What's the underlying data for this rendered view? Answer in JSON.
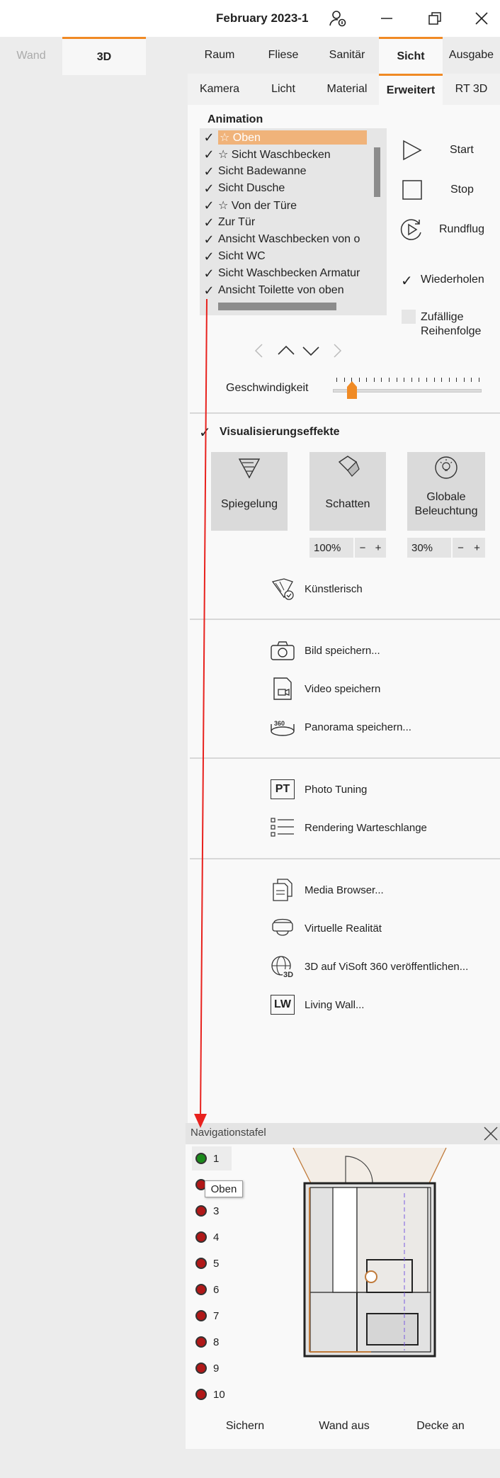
{
  "window": {
    "title": "February 2023-1",
    "controls": [
      "user-settings-icon",
      "minimize-icon",
      "restore-icon",
      "close-icon"
    ]
  },
  "view_tabs": [
    {
      "label": "Wand",
      "active": false
    },
    {
      "label": "3D",
      "active": true
    }
  ],
  "main_tabs": [
    {
      "label": "Raum"
    },
    {
      "label": "Fliese"
    },
    {
      "label": "Sanitär"
    },
    {
      "label": "Sicht",
      "active": true
    },
    {
      "label": "Ausgabe"
    }
  ],
  "sub_tabs": [
    {
      "label": "Kamera"
    },
    {
      "label": "Licht"
    },
    {
      "label": "Material"
    },
    {
      "label": "Erweitert",
      "active": true
    },
    {
      "label": "RT 3D"
    }
  ],
  "animation": {
    "heading": "Animation",
    "items": [
      {
        "label": "☆ Oben",
        "checked": true,
        "selected": true
      },
      {
        "label": "☆ Sicht Waschbecken",
        "checked": true
      },
      {
        "label": "Sicht Badewanne",
        "checked": true
      },
      {
        "label": "Sicht Dusche",
        "checked": true
      },
      {
        "label": "☆ Von der Türe",
        "checked": true
      },
      {
        "label": "Zur Tür",
        "checked": true
      },
      {
        "label": "Ansicht Waschbecken von o",
        "checked": true
      },
      {
        "label": "Sicht WC",
        "checked": true
      },
      {
        "label": "Sicht Waschbecken Armatur",
        "checked": true
      },
      {
        "label": "Ansicht Toilette von oben",
        "checked": true
      }
    ],
    "controls": {
      "start": "Start",
      "stop": "Stop",
      "loop": "Rundflug",
      "repeat": "Wiederholen",
      "repeat_checked": true,
      "random_line1": "Zufällige",
      "random_line2": "Reihenfolge",
      "random_checked": false
    },
    "speed_label": "Geschwindigkeit",
    "speed_level": 0.13
  },
  "effects": {
    "heading": "Visualisierungseffekte",
    "checked": true,
    "tiles": {
      "reflection": "Spiegelung",
      "shadow": "Schatten",
      "gi_line1": "Globale",
      "gi_line2": "Beleuchtung"
    },
    "shadow_pct": "100%",
    "gi_pct": "30%",
    "minus": "−",
    "plus": "+",
    "artistic": "Künstlerisch"
  },
  "export": {
    "save_image": "Bild speichern...",
    "save_video": "Video speichern",
    "save_panorama": "Panorama speichern...",
    "panorama_badge": "360"
  },
  "render": {
    "photo_tuning": "Photo Tuning",
    "pt_badge": "PT",
    "queue": "Rendering Warteschlange"
  },
  "media": {
    "browser": "Media Browser...",
    "vr": "Virtuelle Realität",
    "publish": "3D auf ViSoft 360 veröffentlichen...",
    "publish_badge": "3D",
    "living_wall": "Living Wall...",
    "lw_badge": "LW"
  },
  "navigation": {
    "title": "Navigationstafel",
    "slots": [
      "1",
      "2",
      "3",
      "4",
      "5",
      "6",
      "7",
      "8",
      "9",
      "10"
    ],
    "active_slot": "1",
    "tooltip": "Oben",
    "buttons": {
      "save": "Sichern",
      "wall_off": "Wand aus",
      "ceiling_on": "Decke an"
    }
  },
  "colors": {
    "accent": "#f08a24",
    "selection": "#f0b37a",
    "annotation_arrow": "#e8221e",
    "slot_active": "#1a8a1a",
    "slot_inactive": "#b01818"
  }
}
